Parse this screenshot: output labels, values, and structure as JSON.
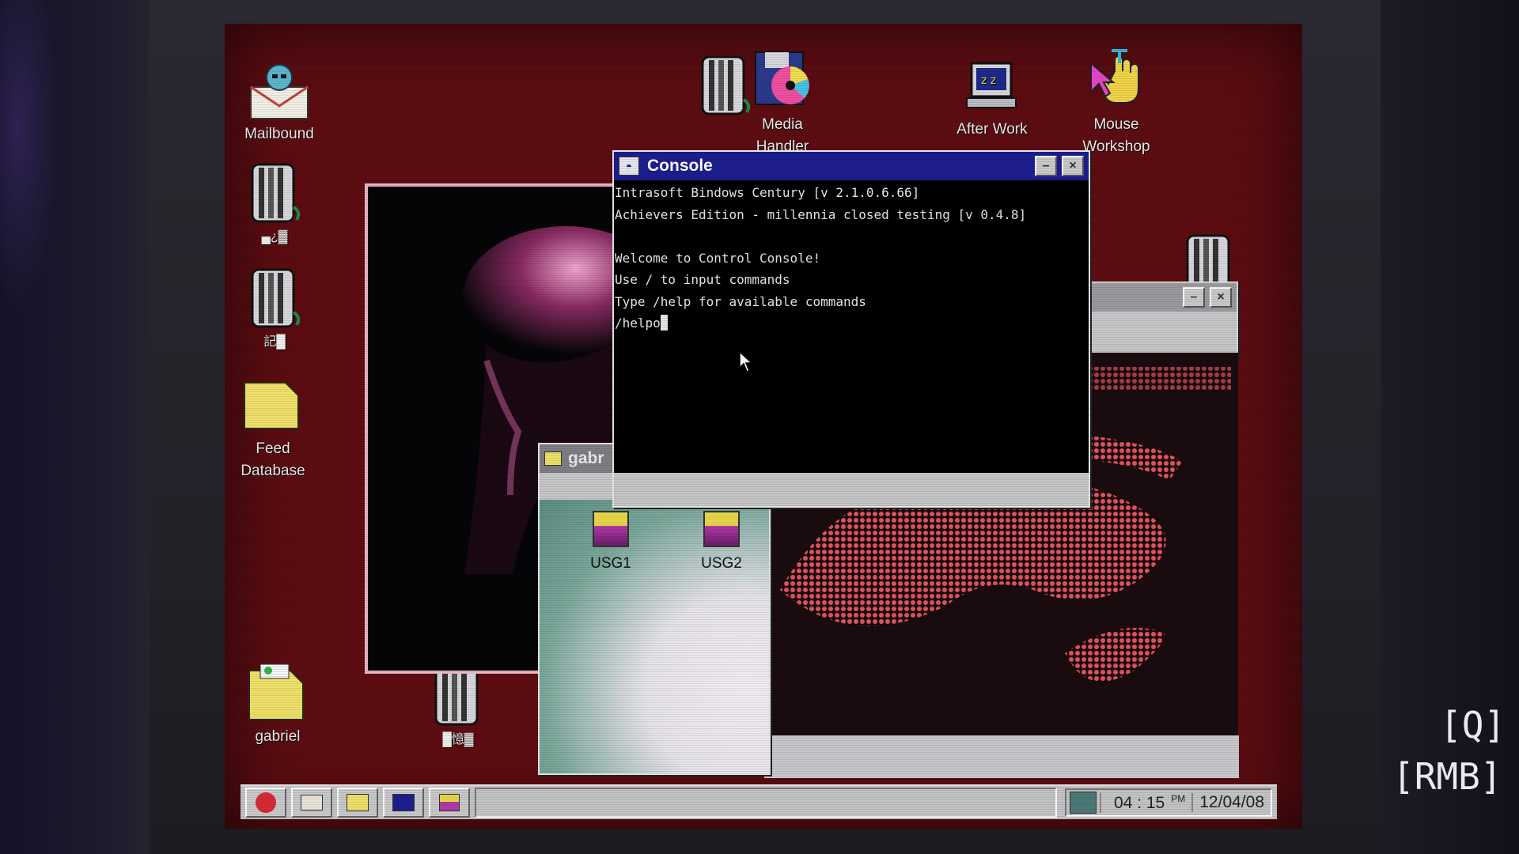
{
  "desktop": {
    "icons": {
      "mailbound": "Mailbound",
      "icon2": "▄¿▓",
      "icon3": "記█",
      "feed_database": "Feed\nDatabase",
      "gabriel": "gabriel",
      "icon_bottom": "█憶▓",
      "media_handler": "Media\nHandler",
      "after_work": "After Work",
      "mouse_workshop": "Mouse\nWorkshop"
    }
  },
  "console": {
    "title": "Console",
    "minimize": "–",
    "close": "×",
    "lines": [
      "Intrasoft Bindows Century [v 2.1.0.6.66]",
      "Achievers Edition - millennia closed testing [v 0.4.8]",
      "",
      "Welcome to Control Console!",
      "Use / to input commands",
      "Type /help for available commands"
    ],
    "input": "/helpo"
  },
  "folder_window": {
    "title": "gabr",
    "files": [
      "USG1",
      "USG2"
    ]
  },
  "image_window": {
    "minimize": "–",
    "close": "×"
  },
  "taskbar": {
    "time": "04 : 15",
    "ampm": "PM",
    "date": "12/04/08"
  },
  "hints": {
    "q": "[Q]",
    "rmb": "[RMB]"
  },
  "colors": {
    "desktop": "#5e0d12",
    "title_active": "#1d1e8f",
    "console_bg": "#000000"
  }
}
